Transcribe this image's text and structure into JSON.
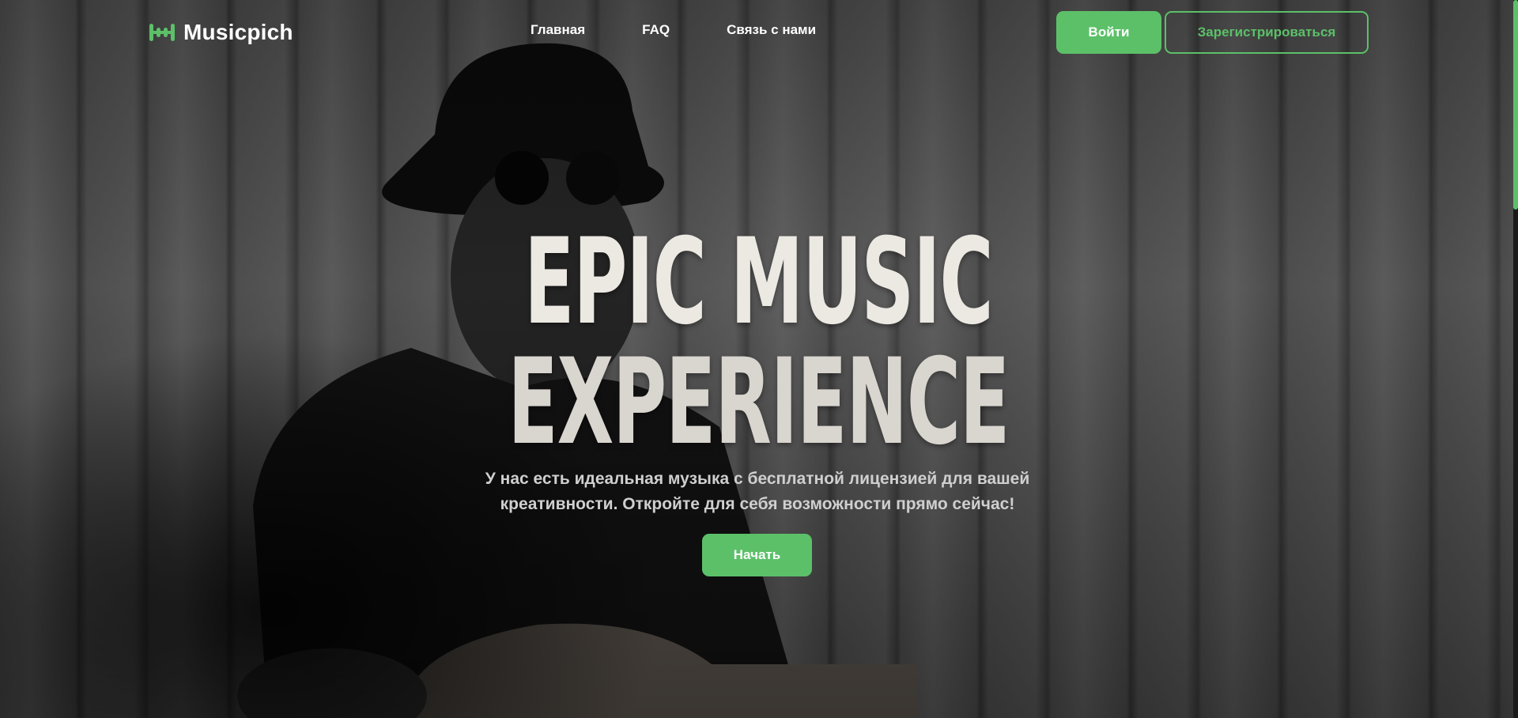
{
  "brand": {
    "name": "Musicpich",
    "icon": "equalizer-logo-icon",
    "accent_color": "#5cc069"
  },
  "nav": {
    "items": [
      {
        "label": "Главная"
      },
      {
        "label": "FAQ"
      },
      {
        "label": "Связь с нами"
      }
    ]
  },
  "auth": {
    "login_label": "Войти",
    "register_label": "Зарегистрироваться"
  },
  "hero": {
    "title_line1": "EPIC MUSIC",
    "title_line2": "EXPERIENCE",
    "subtitle_line1": "У нас есть идеальная музыка с бесплатной лицензией для вашей",
    "subtitle_line2": "креативности. Откройте для себя возможности прямо сейчас!",
    "cta_label": "Начать",
    "background_image": "black-and-white-guitarist-photo"
  }
}
